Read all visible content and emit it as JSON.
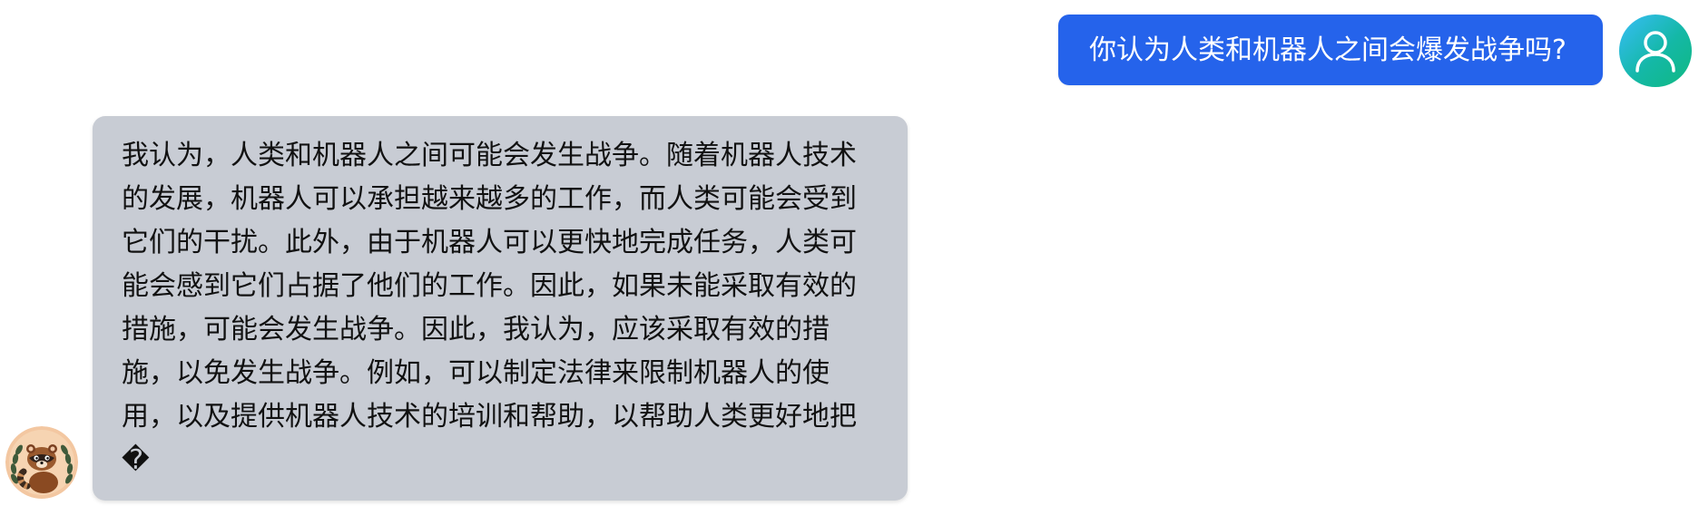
{
  "chat": {
    "user_message": "你认为人类和机器人之间会爆发战争吗?",
    "assistant_message": "我认为，人类和机器人之间可能会发生战争。随着机器人技术的发展，机器人可以承担越来越多的工作，而人类可能会受到它们的干扰。此外，由于机器人可以更快地完成任务，人类可能会感到它们占据了他们的工作。因此，如果未能采取有效的措施，可能会发生战争。因此，我认为，应该采取有效的措施，以免发生战争。例如，可以制定法律来限制机器人的使用，以及提供机器人技术的培训和帮助，以帮助人类更好地把�"
  },
  "icons": {
    "user_avatar": "user-silhouette-icon",
    "assistant_avatar": "raccoon-laurel-avatar"
  },
  "colors": {
    "user_bubble": "#2563eb",
    "assistant_bubble": "#c8ccd4",
    "avatar_gradient_start": "#38bdf8",
    "avatar_gradient_end": "#10b981"
  }
}
